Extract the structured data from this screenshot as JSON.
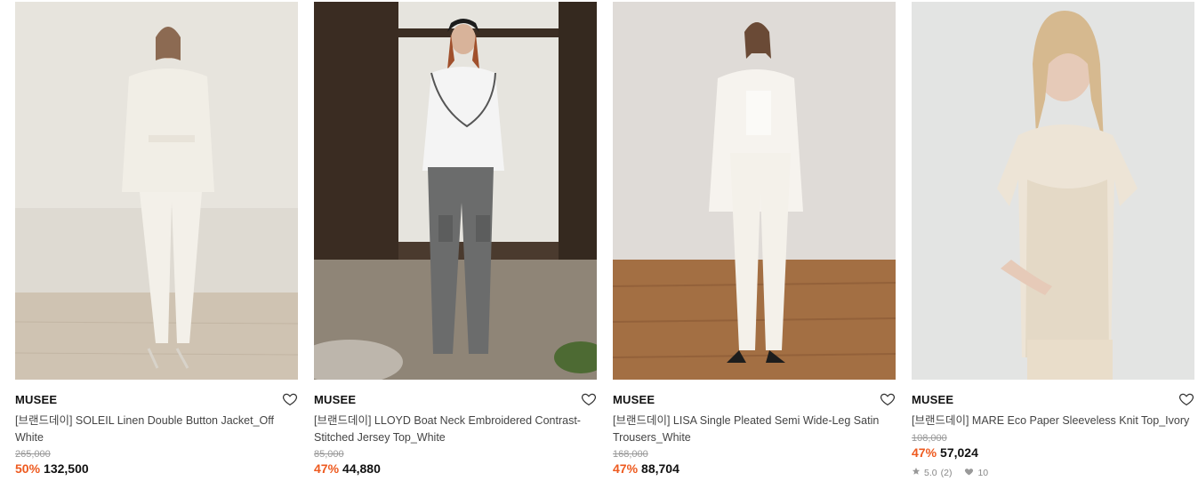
{
  "products": [
    {
      "brand": "MUSEE",
      "title": "[브랜드데이] SOLEIL Linen Double Button Jacket_Off White",
      "original_price": "265,000",
      "discount": "50%",
      "price": "132,500"
    },
    {
      "brand": "MUSEE",
      "title": "[브랜드데이] LLOYD Boat Neck Embroidered Contrast-Stitched Jersey Top_White",
      "original_price": "85,000",
      "discount": "47%",
      "price": "44,880"
    },
    {
      "brand": "MUSEE",
      "title": "[브랜드데이] LISA Single Pleated Semi Wide-Leg Satin Trousers_White",
      "original_price": "168,000",
      "discount": "47%",
      "price": "88,704"
    },
    {
      "brand": "MUSEE",
      "title": "[브랜드데이] MARE Eco Paper Sleeveless Knit Top_Ivory",
      "original_price": "108,000",
      "discount": "47%",
      "price": "57,024",
      "rating": "5.0",
      "review_count": "(2)",
      "likes": "10"
    }
  ],
  "icons": {
    "wishlist": "heart-outline-icon",
    "rating": "star-icon",
    "likes": "heart-filled-icon"
  },
  "colors": {
    "discount": "#ee5a1f",
    "strike_price": "#999999"
  }
}
